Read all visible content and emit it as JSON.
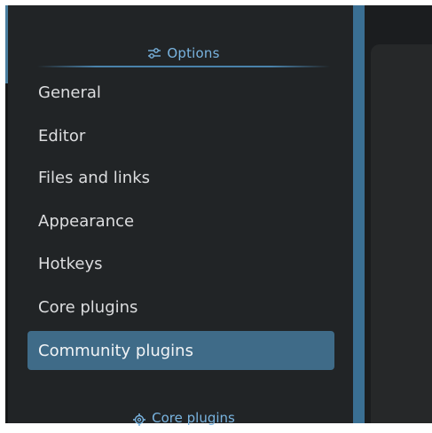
{
  "sidebar": {
    "options_header": "Options",
    "options_icon": "sliders-icon",
    "items": [
      {
        "label": "General"
      },
      {
        "label": "Editor"
      },
      {
        "label": "Files and links"
      },
      {
        "label": "Appearance"
      },
      {
        "label": "Hotkeys"
      },
      {
        "label": "Core plugins"
      },
      {
        "label": "Community plugins"
      }
    ],
    "active_item": "Community plugins",
    "core_plugins_header": "Core plugins",
    "core_plugins_icon": "gear-icon"
  },
  "colors": {
    "sidebar_bg": "#212426",
    "accent": "#79b4e0",
    "active_bg": "#3f6b88",
    "divider": "#3a6f93"
  }
}
